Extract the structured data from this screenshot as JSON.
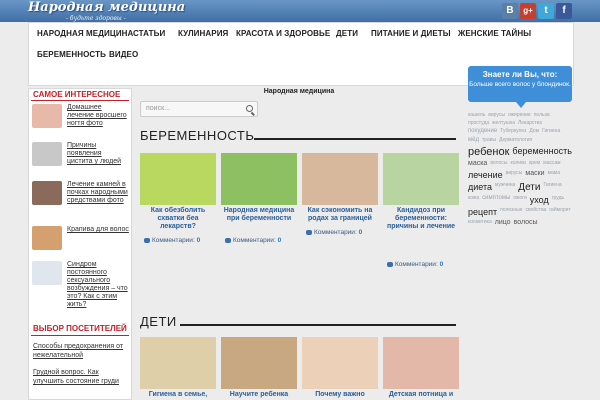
{
  "header": {
    "logo": "Народная медицина",
    "tagline": "- будьте здоровы -",
    "social": [
      "В",
      "g+",
      "t",
      "f"
    ]
  },
  "nav": {
    "row1": [
      "НАРОДНАЯ МЕДИЦИНА",
      "СТАТЬИ",
      "КУЛИНАРИЯ",
      "КРАСОТА И ЗДОРОВЬЕ",
      "ДЕТИ",
      "ПИТАНИЕ И ДИЕТЫ",
      "ЖЕНСКИЕ ТАЙНЫ"
    ],
    "row2": [
      "БЕРЕМЕННОСТЬ",
      "ВИДЕО"
    ]
  },
  "left": {
    "popular_title": "САМОЕ ИНТЕРЕСНОЕ",
    "popular": [
      {
        "text": "Домашнее лечение вросшего ногтя фото",
        "color": "#e8b8a8"
      },
      {
        "text": "Причины появления цистита у людей",
        "color": "#c8c8c8"
      },
      {
        "text": "Лечение камней в почках народными средствами фото",
        "color": "#8a6a5a"
      },
      {
        "text": "Крапива для волос",
        "color": "#d4a070"
      },
      {
        "text": "Синдром постоянного сексуального возбуждения – что это? Как с этим жить?",
        "color": "#dfe6ee"
      }
    ],
    "visitors_title": "ВЫБОР ПОСЕТИТЕЛЕЙ",
    "visitors": [
      "Способы предохранения от нежелательной",
      "Грудной вопрос. Как улучшить состояние груди"
    ]
  },
  "main": {
    "title": "Народная медицина",
    "search_placeholder": "поиск...",
    "sections": [
      {
        "heading": "БЕРЕМЕННОСТЬ",
        "cards": [
          {
            "title": "Как обезболить схватки беа лекарств?",
            "comments_label": "Комментарии:",
            "comments": "0",
            "color": "#b8d860"
          },
          {
            "title": "Народная медицина при беременности",
            "comments_label": "Комментарии:",
            "comments": "0",
            "color": "#8cc060"
          },
          {
            "title": "Как сэкономить на родах за границей",
            "comments_label": "Комментарии:",
            "comments": "0",
            "color": "#d8b89c"
          },
          {
            "title": "Кандидоз при беременности: причины и лечение",
            "comments_label": "Комментарии:",
            "comments": "0",
            "color": "#b8d4a0"
          }
        ]
      },
      {
        "heading": "ДЕТИ",
        "cards": [
          {
            "title": "Гигиена в семье,",
            "color": "#dfcfa8"
          },
          {
            "title": "Научите ребенка",
            "color": "#c8a880"
          },
          {
            "title": "Почему важно",
            "color": "#ecd0b8"
          },
          {
            "title": "Детская потница и",
            "color": "#e4b8a8"
          }
        ]
      }
    ]
  },
  "right": {
    "tip_title": "Знаете ли Вы, что:",
    "tip_text": "Больше всего волос у блондинок.",
    "tags": [
      {
        "t": "кашель",
        "s": 5
      },
      {
        "t": "вирусы",
        "s": 5
      },
      {
        "t": "ожирение",
        "s": 5
      },
      {
        "t": "польза",
        "s": 5
      },
      {
        "t": "простуда",
        "s": 5
      },
      {
        "t": "желтушка",
        "s": 5
      },
      {
        "t": "Лекарства",
        "s": 5
      },
      {
        "t": "похудение",
        "s": 6
      },
      {
        "t": "Туберкулез",
        "s": 5
      },
      {
        "t": "Дом",
        "s": 5
      },
      {
        "t": "Гигиена",
        "s": 5
      },
      {
        "t": "мёд",
        "s": 6
      },
      {
        "t": "травы",
        "s": 5
      },
      {
        "t": "Дерматология",
        "s": 5
      },
      {
        "t": "ребенок",
        "s": 11
      },
      {
        "t": "беременность",
        "s": 9
      },
      {
        "t": "маска",
        "s": 7
      },
      {
        "t": "волосы",
        "s": 5
      },
      {
        "t": "колики",
        "s": 5
      },
      {
        "t": "крем",
        "s": 5
      },
      {
        "t": "массаж",
        "s": 5
      },
      {
        "t": "лечение",
        "s": 9
      },
      {
        "t": "вирусы",
        "s": 5
      },
      {
        "t": "маски",
        "s": 7
      },
      {
        "t": "мама",
        "s": 5
      },
      {
        "t": "диета",
        "s": 9
      },
      {
        "t": "мужчина",
        "s": 5
      },
      {
        "t": "Дети",
        "s": 10
      },
      {
        "t": "Гигиена",
        "s": 5
      },
      {
        "t": "кожа",
        "s": 5
      },
      {
        "t": "симптомы",
        "s": 6
      },
      {
        "t": "ожоги",
        "s": 5
      },
      {
        "t": "уход",
        "s": 9
      },
      {
        "t": "грудь",
        "s": 5
      },
      {
        "t": "рецепт",
        "s": 9
      },
      {
        "t": "полезные",
        "s": 5
      },
      {
        "t": "свойства",
        "s": 5
      },
      {
        "t": "гайморит",
        "s": 5
      },
      {
        "t": "косметика",
        "s": 5
      },
      {
        "t": "лицо",
        "s": 7
      },
      {
        "t": "волосы",
        "s": 7
      }
    ]
  }
}
